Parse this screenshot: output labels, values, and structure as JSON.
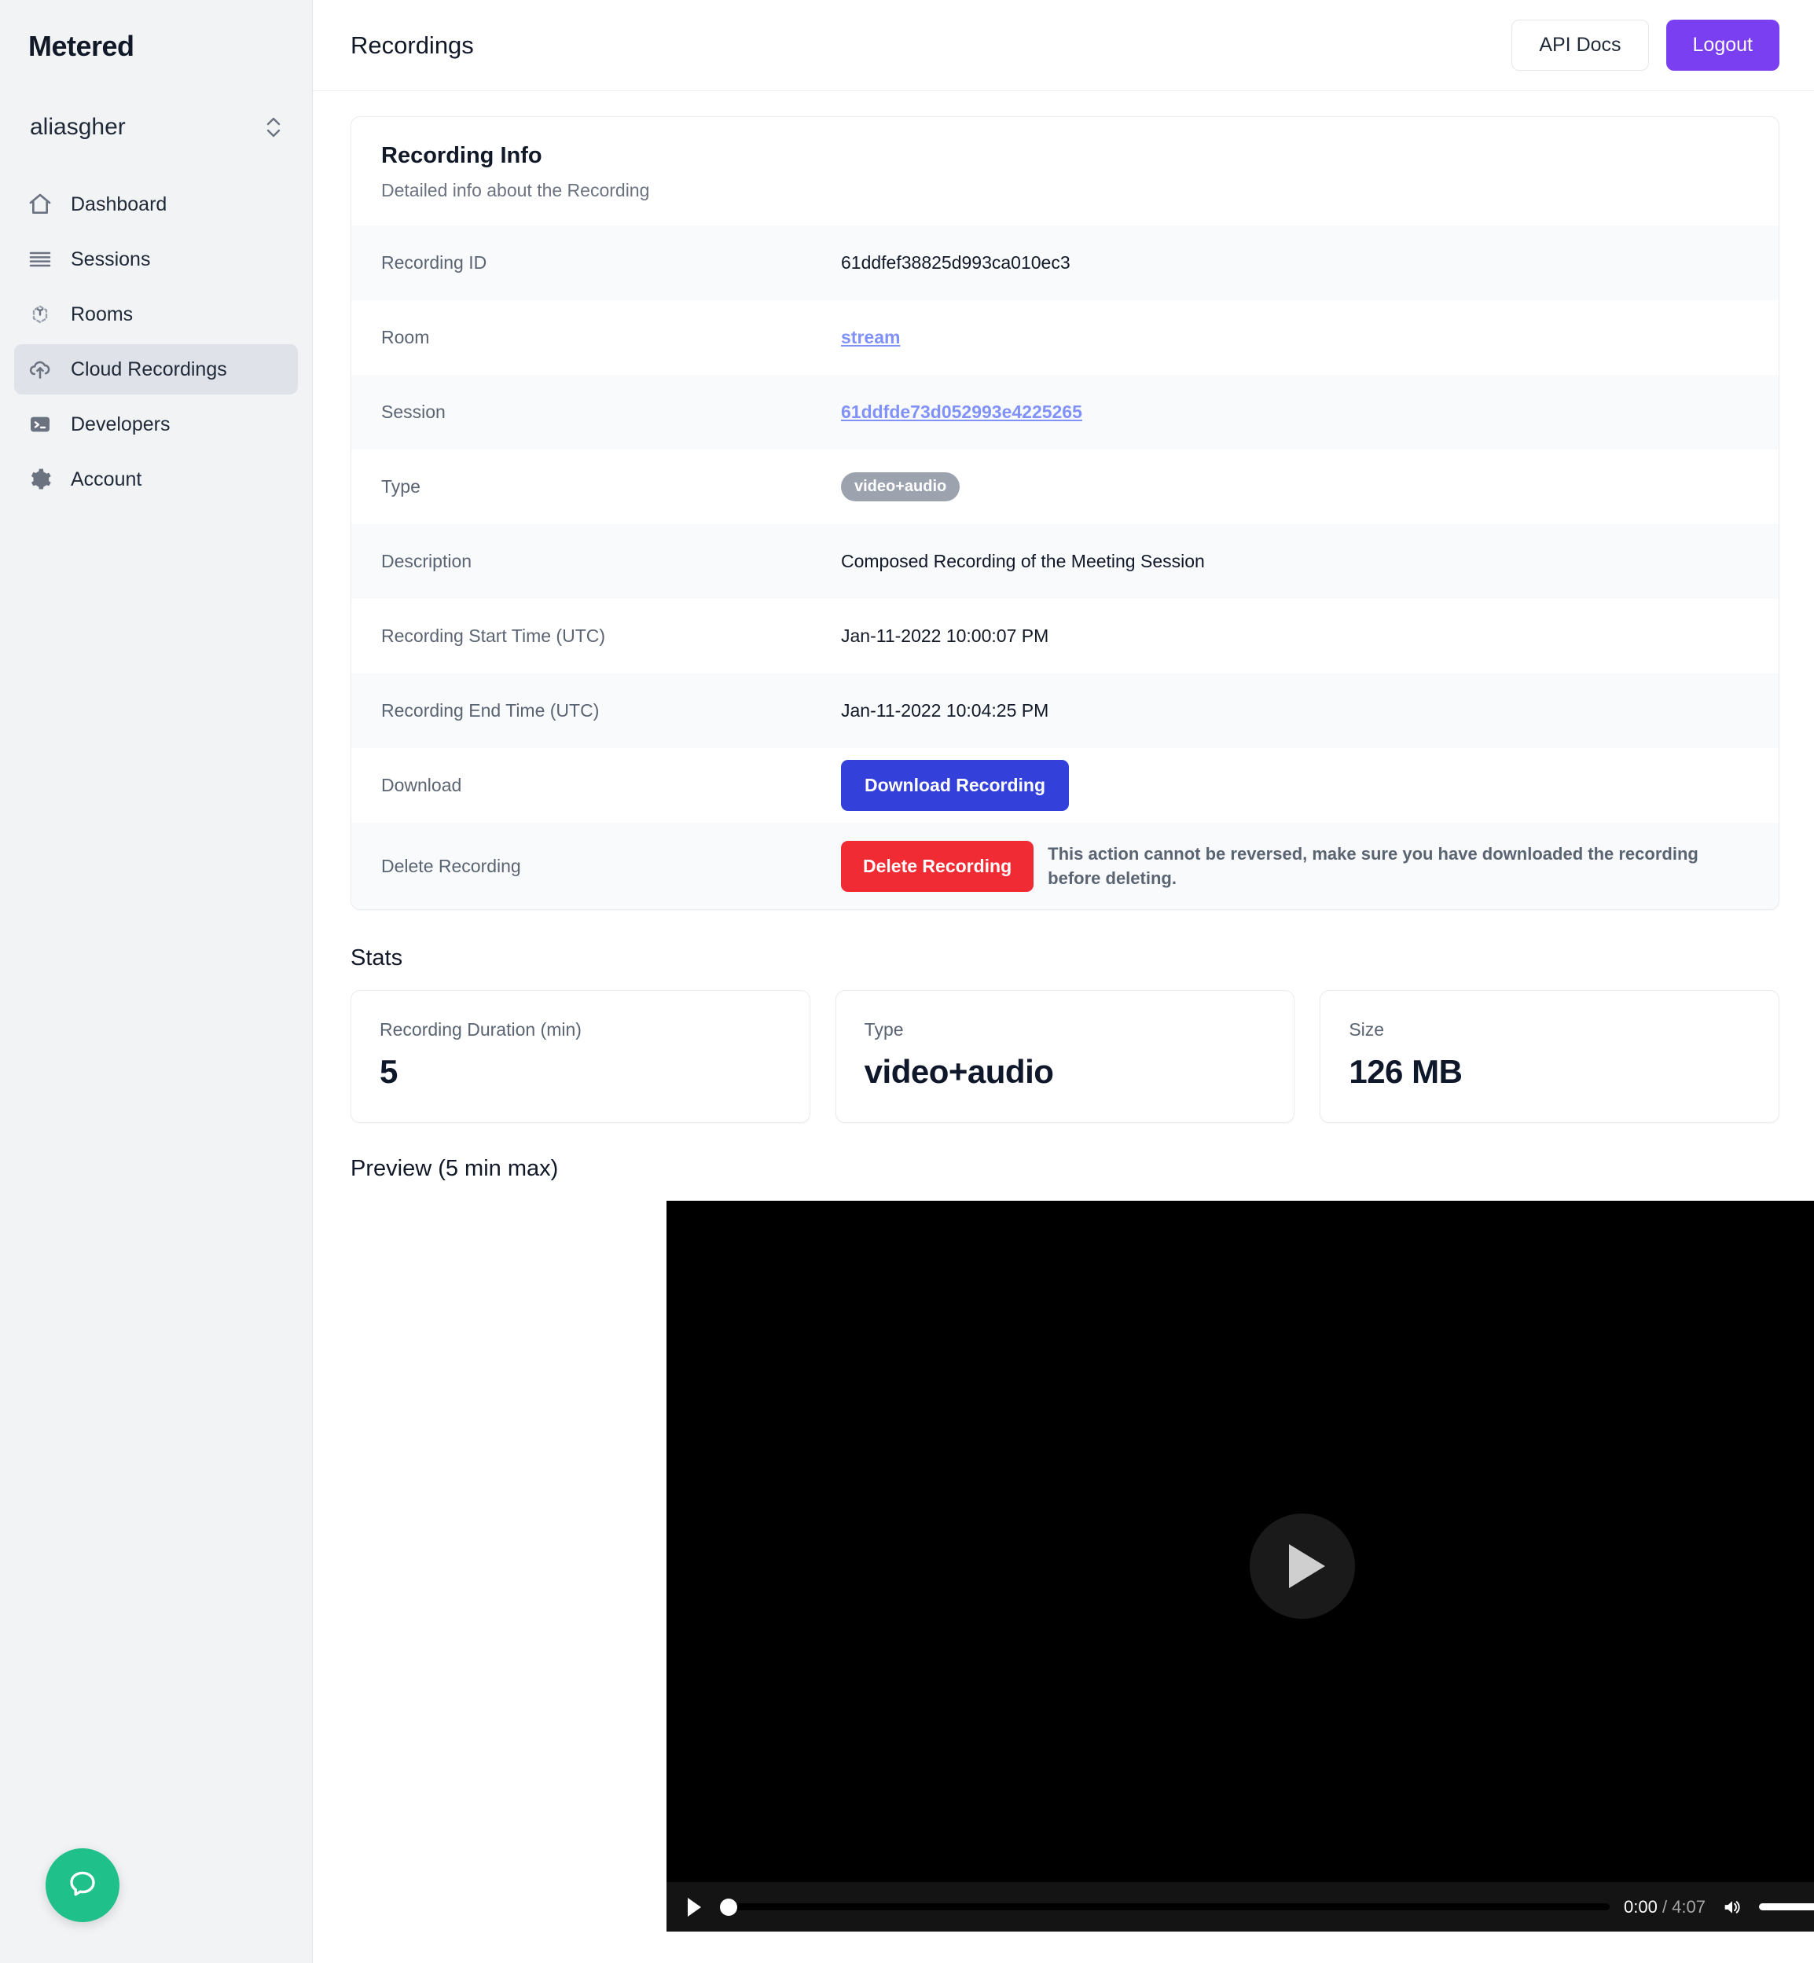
{
  "sidebar": {
    "brand": "Metered",
    "org": "aliasgher",
    "items": [
      {
        "label": "Dashboard",
        "icon": "home-icon"
      },
      {
        "label": "Sessions",
        "icon": "list-icon"
      },
      {
        "label": "Rooms",
        "icon": "rooms-icon"
      },
      {
        "label": "Cloud Recordings",
        "icon": "cloud-upload-icon"
      },
      {
        "label": "Developers",
        "icon": "terminal-icon"
      },
      {
        "label": "Account",
        "icon": "gear-icon"
      }
    ],
    "active_index": 3,
    "help_icon": "chat-bubble-icon",
    "help_color": "#1fc08a"
  },
  "topbar": {
    "title": "Recordings",
    "api_docs_label": "API Docs",
    "logout_label": "Logout",
    "logout_color": "#7b3ff2"
  },
  "recording_info": {
    "title": "Recording Info",
    "subtitle": "Detailed info about the Recording",
    "rows": [
      {
        "label": "Recording ID",
        "value": "61ddfef38825d993ca010ec3",
        "kind": "text"
      },
      {
        "label": "Room",
        "value": "stream",
        "kind": "link"
      },
      {
        "label": "Session",
        "value": "61ddfde73d052993e4225265",
        "kind": "link"
      },
      {
        "label": "Type",
        "value": "video+audio",
        "kind": "badge"
      },
      {
        "label": "Description",
        "value": "Composed Recording of the Meeting Session",
        "kind": "text"
      },
      {
        "label": "Recording Start Time (UTC)",
        "value": "Jan-11-2022 10:00:07 PM",
        "kind": "text"
      },
      {
        "label": "Recording End Time (UTC)",
        "value": "Jan-11-2022 10:04:25 PM",
        "kind": "text"
      }
    ],
    "download": {
      "label": "Download",
      "button_label": "Download Recording",
      "button_color": "#3340d9"
    },
    "delete": {
      "label": "Delete Recording",
      "button_label": "Delete Recording",
      "button_color": "#f02b34",
      "warning": "This action cannot be reversed, make sure you have downloaded the recording before deleting."
    }
  },
  "stats": {
    "title": "Stats",
    "cards": [
      {
        "label": "Recording Duration (min)",
        "value": "5"
      },
      {
        "label": "Type",
        "value": "video+audio"
      },
      {
        "label": "Size",
        "value": "126 MB"
      }
    ]
  },
  "preview": {
    "title": "Preview (5 min max)",
    "player": {
      "current_time": "0:00",
      "separator": " / ",
      "duration": "4:07",
      "play_icon": "play-icon",
      "volume_icon": "volume-on-icon",
      "fullscreen_icon": "fullscreen-icon"
    }
  }
}
